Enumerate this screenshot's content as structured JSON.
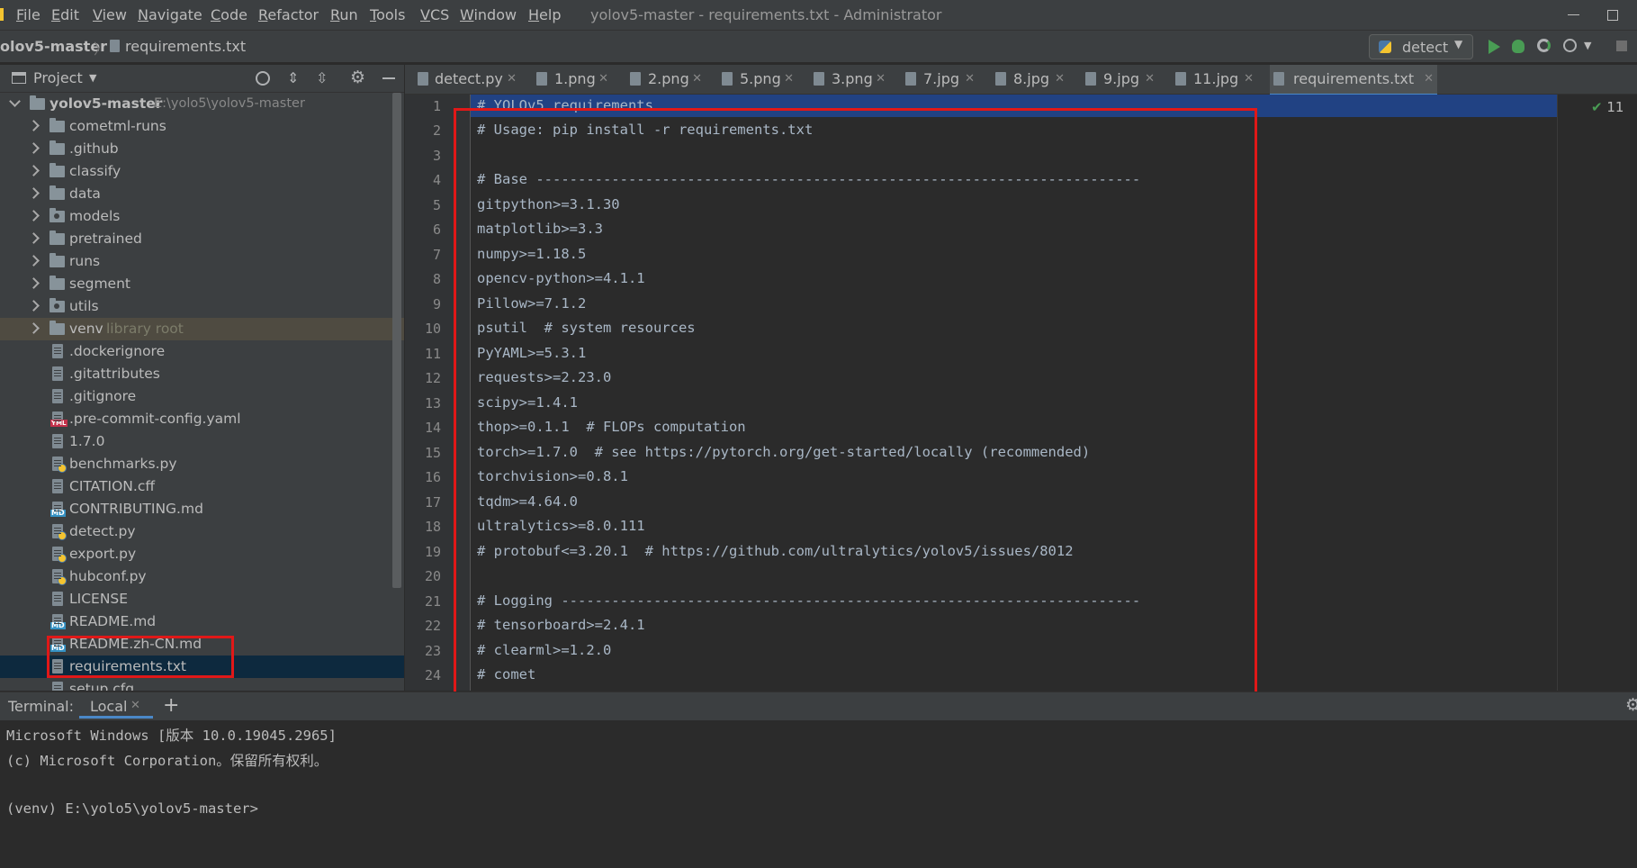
{
  "window": {
    "title": "yolov5-master - requirements.txt - Administrator"
  },
  "menu": [
    "File",
    "Edit",
    "View",
    "Navigate",
    "Code",
    "Refactor",
    "Run",
    "Tools",
    "VCS",
    "Window",
    "Help"
  ],
  "breadcrumb": {
    "project": "olov5-master",
    "file": "requirements.txt"
  },
  "run_config": {
    "label": "detect"
  },
  "project_panel": {
    "title": "Project",
    "root": {
      "name": "yolov5-master",
      "path": "E:\\yolo5\\yolov5-master"
    },
    "items": [
      {
        "label": "cometml-runs",
        "kind": "folder"
      },
      {
        "label": ".github",
        "kind": "folder"
      },
      {
        "label": "classify",
        "kind": "folder"
      },
      {
        "label": "data",
        "kind": "folder"
      },
      {
        "label": "models",
        "kind": "folder"
      },
      {
        "label": "pretrained",
        "kind": "folder"
      },
      {
        "label": "runs",
        "kind": "folder"
      },
      {
        "label": "segment",
        "kind": "folder"
      },
      {
        "label": "utils",
        "kind": "folder"
      },
      {
        "label": "venv",
        "kind": "folder",
        "note": "library root"
      },
      {
        "label": ".dockerignore",
        "kind": "file"
      },
      {
        "label": ".gitattributes",
        "kind": "file"
      },
      {
        "label": ".gitignore",
        "kind": "file"
      },
      {
        "label": ".pre-commit-config.yaml",
        "kind": "yml"
      },
      {
        "label": "1.7.0",
        "kind": "file"
      },
      {
        "label": "benchmarks.py",
        "kind": "py"
      },
      {
        "label": "CITATION.cff",
        "kind": "file"
      },
      {
        "label": "CONTRIBUTING.md",
        "kind": "md"
      },
      {
        "label": "detect.py",
        "kind": "py"
      },
      {
        "label": "export.py",
        "kind": "py"
      },
      {
        "label": "hubconf.py",
        "kind": "py"
      },
      {
        "label": "LICENSE",
        "kind": "file"
      },
      {
        "label": "README.md",
        "kind": "md"
      },
      {
        "label": "README.zh-CN.md",
        "kind": "md"
      },
      {
        "label": "requirements.txt",
        "kind": "file"
      },
      {
        "label": "setup.cfg",
        "kind": "file"
      }
    ]
  },
  "tabs": [
    {
      "label": "detect.py"
    },
    {
      "label": "1.png"
    },
    {
      "label": "2.png"
    },
    {
      "label": "5.png"
    },
    {
      "label": "3.png"
    },
    {
      "label": "7.jpg"
    },
    {
      "label": "8.jpg"
    },
    {
      "label": "9.jpg"
    },
    {
      "label": "11.jpg"
    },
    {
      "label": "requirements.txt"
    }
  ],
  "editor": {
    "inspection_count": "11",
    "line_numbers": [
      "1",
      "2",
      "3",
      "4",
      "5",
      "6",
      "7",
      "8",
      "9",
      "10",
      "11",
      "12",
      "13",
      "14",
      "15",
      "16",
      "17",
      "18",
      "19",
      "20",
      "21",
      "22",
      "23",
      "24"
    ],
    "lines": [
      "# YOLOv5 requirements",
      "# Usage: pip install -r requirements.txt",
      "",
      "# Base ------------------------------------------------------------------------",
      "gitpython>=3.1.30",
      "matplotlib>=3.3",
      "numpy>=1.18.5",
      "opencv-python>=4.1.1",
      "Pillow>=7.1.2",
      "psutil  # system resources",
      "PyYAML>=5.3.1",
      "requests>=2.23.0",
      "scipy>=1.4.1",
      "thop>=0.1.1  # FLOPs computation",
      "torch>=1.7.0  # see https://pytorch.org/get-started/locally (recommended)",
      "torchvision>=0.8.1",
      "tqdm>=4.64.0",
      "ultralytics>=8.0.111",
      "# protobuf<=3.20.1  # https://github.com/ultralytics/yolov5/issues/8012",
      "",
      "# Logging ---------------------------------------------------------------------",
      "# tensorboard>=2.4.1",
      "# clearml>=1.2.0",
      "# comet"
    ]
  },
  "terminal": {
    "title": "Terminal:",
    "tab": "Local",
    "lines": [
      "Microsoft Windows [版本 10.0.19045.2965]",
      "(c) Microsoft Corporation。保留所有权利。",
      "",
      "(venv) E:\\yolo5\\yolov5-master>"
    ]
  },
  "colors": {
    "accent": "#4a88c7",
    "highlight_box": "#e01818",
    "run_green": "#499c54"
  }
}
